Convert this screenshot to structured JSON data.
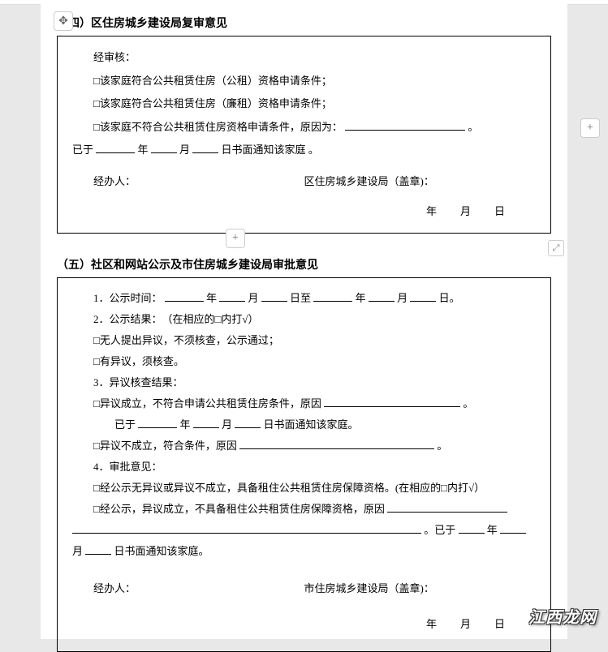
{
  "section4": {
    "title": "（四）区住房城乡建设局复审意见",
    "intro": "经审核：",
    "opt1": "□该家庭符合公共租赁住房（公租）资格申请条件；",
    "opt2": "□该家庭符合公共租赁住房（廉租）资格申请条件；",
    "opt3a": "□该家庭不符合公共租赁住房资格申请条件，原因为：",
    "opt3b": "。",
    "notify_a": "已于",
    "notify_b": "年",
    "notify_c": "月",
    "notify_d": "日书面通知该家庭 。",
    "handler": "经办人：",
    "stamp": "区住房城乡建设局（盖章)：",
    "date": "年　月　日"
  },
  "section5": {
    "title": "（五）社区和网站公示及市住房城乡建设局审批意见",
    "p1_a": "1．公示时间：",
    "p1_b": "年",
    "p1_c": "月",
    "p1_d": "日至",
    "p1_e": "年",
    "p1_f": "月",
    "p1_g": "日。",
    "p2": "2．公示结果：　（在相应的□内打√）",
    "p2a": "□无人提出异议，不须核查，公示通过；",
    "p2b": "□有异议，须核查。",
    "p3": "3．异议核查结果：",
    "p3a_a": "□异议成立，不符合申请公共租赁住房条件，原因",
    "p3a_b": "。",
    "p3n_a": "已于",
    "p3n_b": "年",
    "p3n_c": "月",
    "p3n_d": "日书面通知该家庭。",
    "p3b_a": "□异议不成立，符合条件，原因",
    "p3b_b": "。",
    "p4": "4．审批意见：",
    "p4a": "□经公示无异议或异议不成立，具备租住公共租赁住房保障资格。(在相应的□内打√）",
    "p4b_a": "□经公示，异议成立，不具备租住公共租赁住房保障资格，原因",
    "p4n_a": "。已于",
    "p4n_b": "年",
    "p4n_c": "月",
    "p4n_d": "日书面通知该家庭。",
    "handler": "经办人：",
    "stamp": "市住房城乡建设局（盖章)：",
    "date": "年　月　日"
  },
  "watermark": "江西龙网"
}
